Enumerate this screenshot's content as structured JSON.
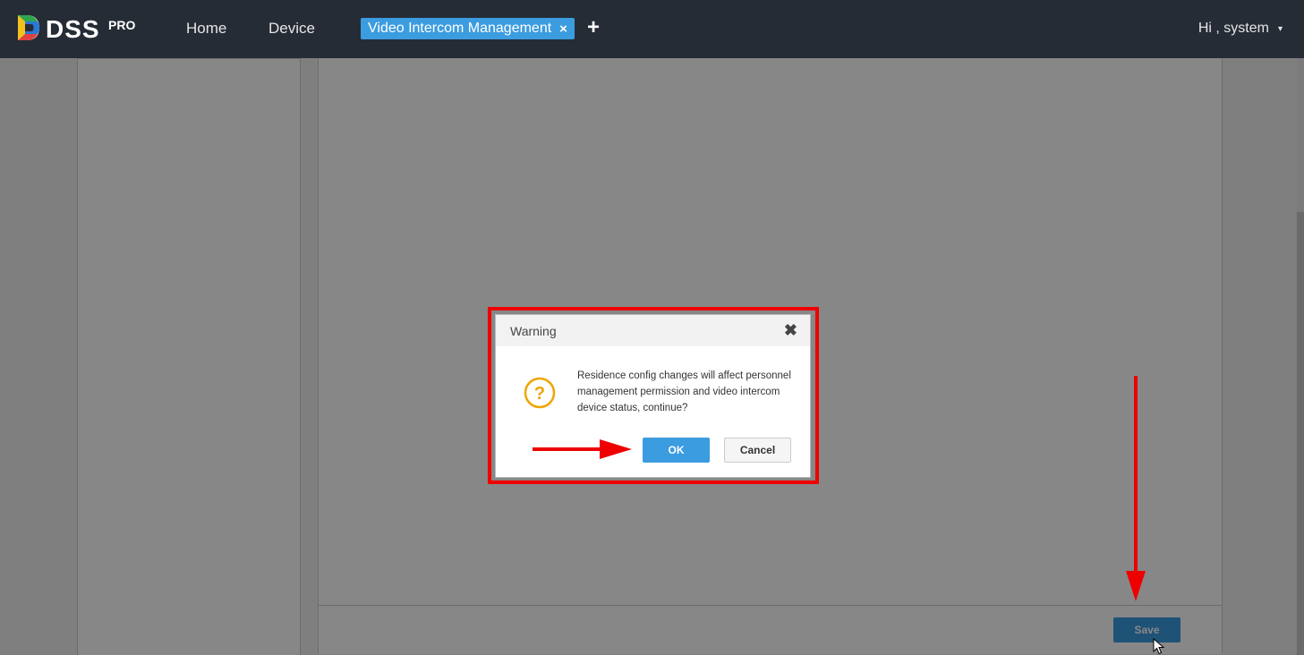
{
  "header": {
    "brand": "DSS",
    "brand_sup": "PRO",
    "nav": [
      "Home",
      "Device"
    ],
    "active_tab": "Video Intercom Management",
    "tab_close": "×",
    "add_tab": "+",
    "user_greeting": "Hi , system",
    "user_caret": "▾"
  },
  "footer": {
    "save_label": "Save"
  },
  "dialog": {
    "title": "Warning",
    "close": "✖",
    "icon": "question-icon",
    "message": "Residence config changes will affect personnel management permission and video intercom device status, continue?",
    "ok_label": "OK",
    "cancel_label": "Cancel"
  },
  "colors": {
    "topbar": "#262c36",
    "accent": "#3c9ce0",
    "annotation": "#ee0000",
    "warning_icon": "#f0a500"
  }
}
